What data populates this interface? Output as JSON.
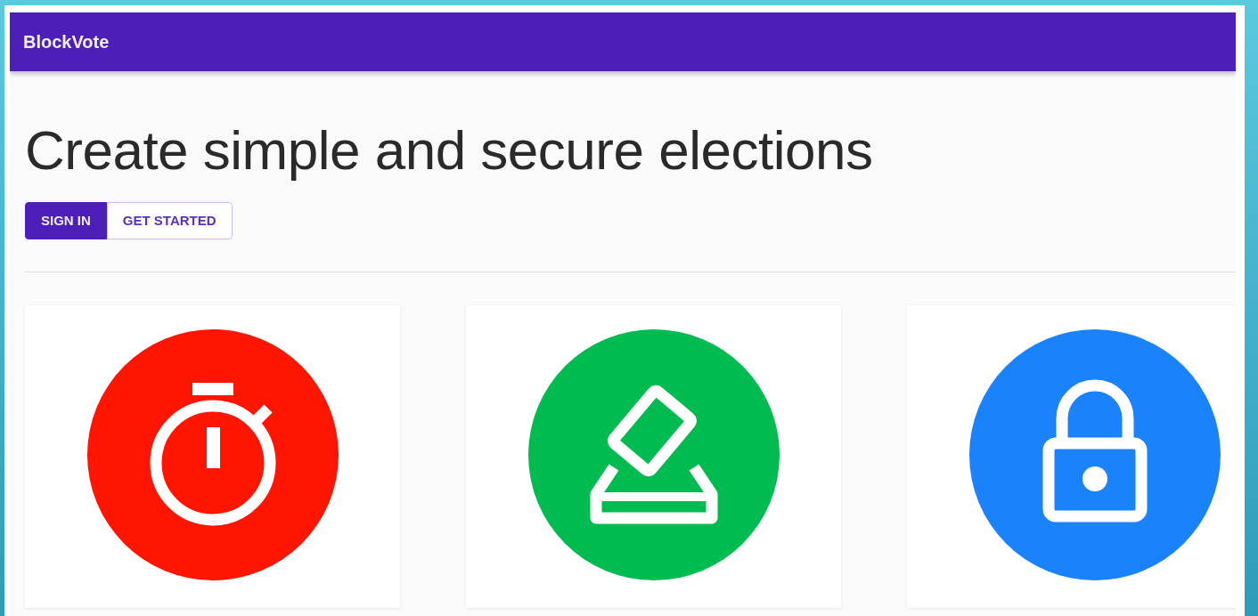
{
  "navbar": {
    "brand": "BlockVote"
  },
  "hero": {
    "heading": "Create simple and secure elections",
    "buttons": [
      {
        "label": "SIGN IN",
        "selected": true
      },
      {
        "label": "GET STARTED",
        "selected": false
      }
    ]
  },
  "features": [
    {
      "kind": "timer",
      "color": "#ff1500"
    },
    {
      "kind": "ballot",
      "color": "#00bb50"
    },
    {
      "kind": "lock",
      "color": "#1a82fa"
    }
  ]
}
